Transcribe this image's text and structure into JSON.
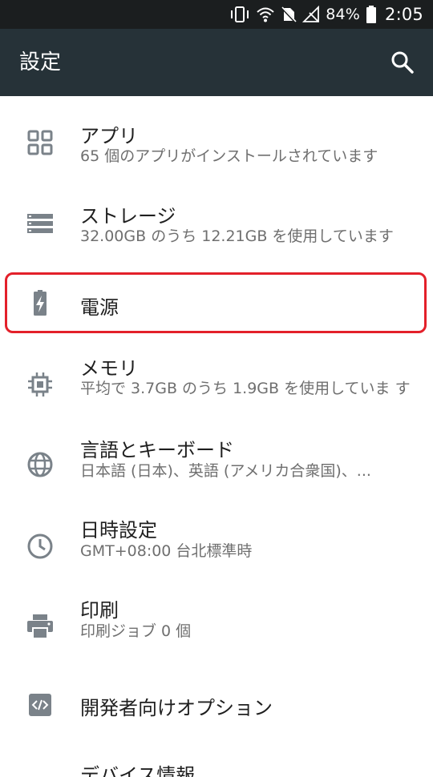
{
  "status_bar": {
    "battery": "84%",
    "time": "2:05",
    "icons": [
      "vibrate-icon",
      "wifi-icon",
      "no-sim-icon",
      "signal-off-icon",
      "battery-icon"
    ]
  },
  "app_bar": {
    "title": "設定",
    "search_icon": "search-icon"
  },
  "items": [
    {
      "title": "アプリ",
      "summary": "65 個のアプリがインストールされています",
      "icon": "apps-icon"
    },
    {
      "title": "ストレージ",
      "summary": "32.00GB のうち 12.21GB を使用しています",
      "icon": "storage-icon"
    },
    {
      "title": "電源",
      "summary": "",
      "icon": "battery-charging-icon"
    },
    {
      "title": "メモリ",
      "summary": "平均で 3.7GB のうち 1.9GB を使用していま す",
      "icon": "memory-icon"
    },
    {
      "title": "言語とキーボード",
      "summary": "日本語 (日本)、英語 (アメリカ合衆国)、...",
      "icon": "language-icon"
    },
    {
      "title": "日時設定",
      "summary": "GMT+08:00 台北標準時",
      "icon": "clock-icon"
    },
    {
      "title": "印刷",
      "summary": "印刷ジョブ 0 個",
      "icon": "print-icon"
    },
    {
      "title": "開発者向けオプション",
      "summary": "",
      "icon": "developer-icon"
    },
    {
      "title": "デバイス情報",
      "summary": "",
      "icon": "info-icon"
    }
  ]
}
